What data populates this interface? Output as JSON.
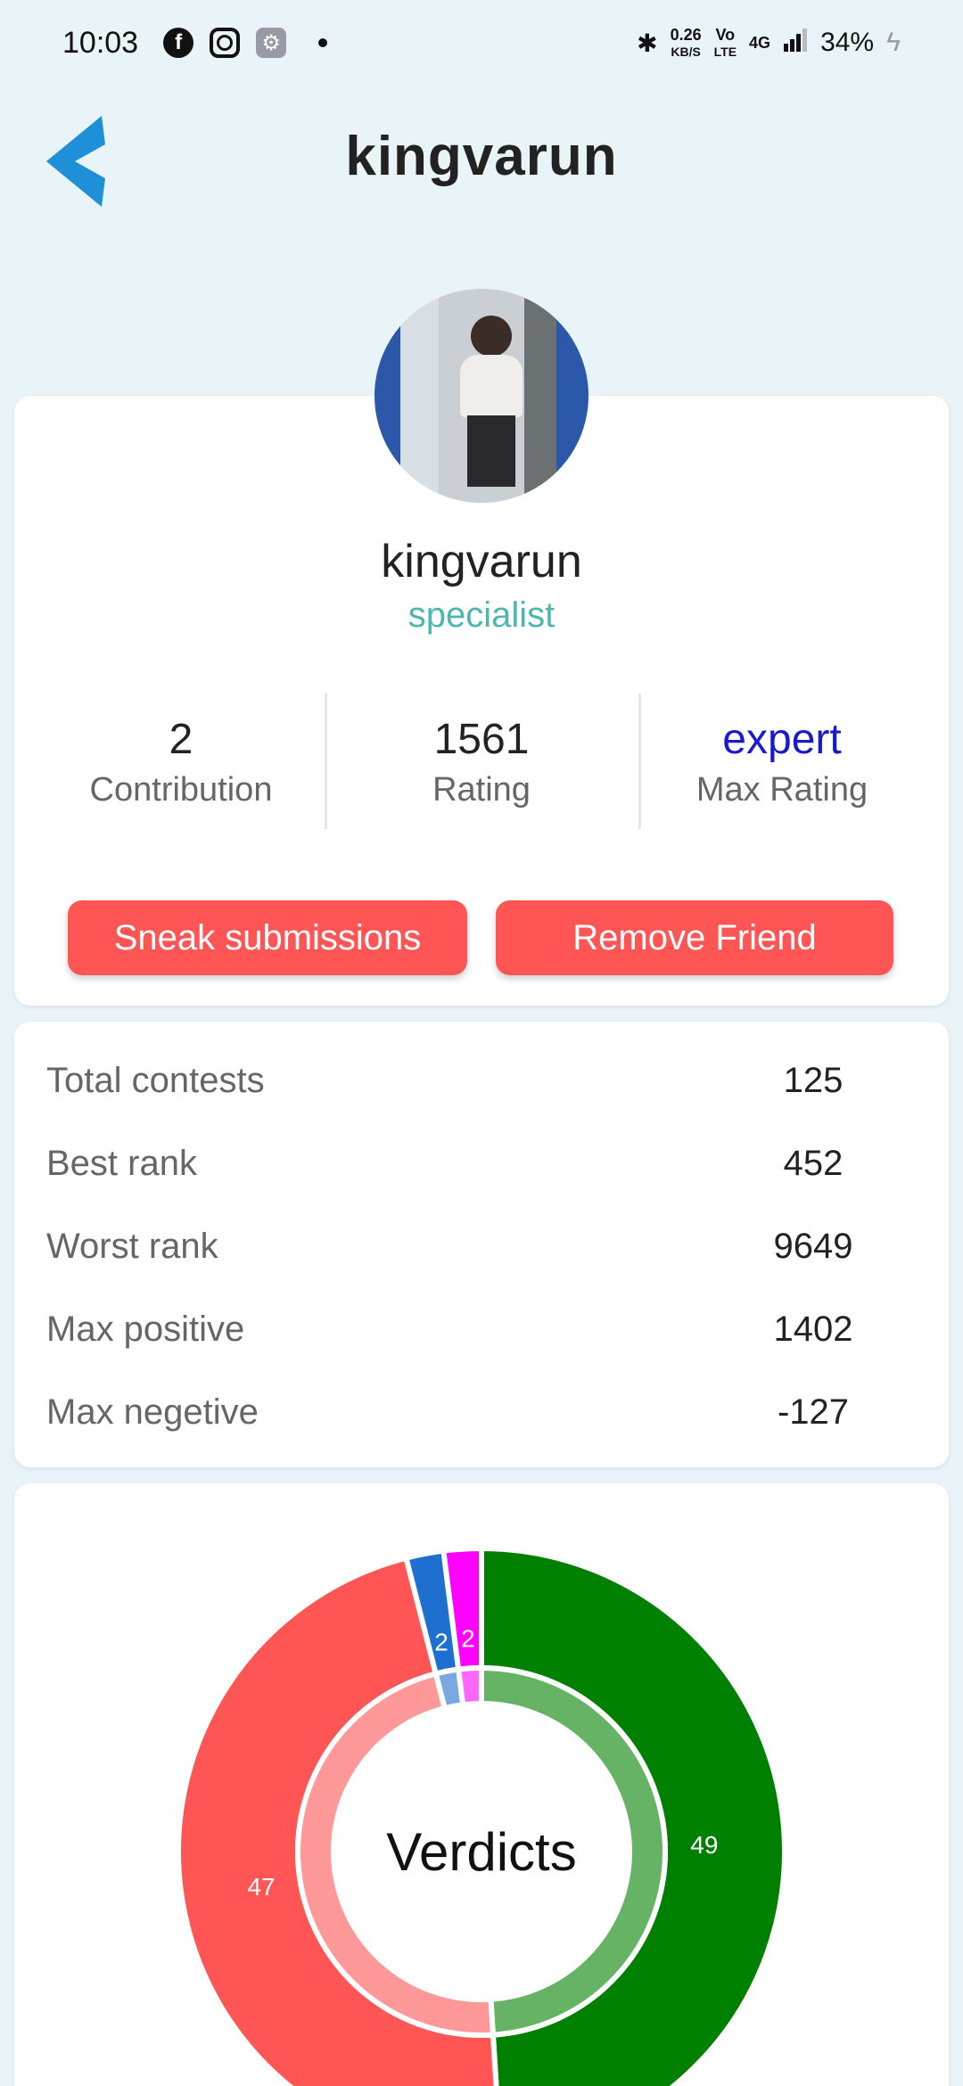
{
  "status_bar": {
    "time": "10:03",
    "network_speed_value": "0.26",
    "network_speed_unit": "KB/S",
    "volte_top": "Vo",
    "volte_bottom": "LTE",
    "network_type": "4G",
    "battery": "34%",
    "icons": [
      "facebook-icon",
      "instagram-icon",
      "settings-app-icon",
      "notification-dot",
      "bluetooth-icon",
      "signal-icon",
      "charging-icon"
    ]
  },
  "app_bar": {
    "title": "kingvarun",
    "back_icon": "chevron-left-icon",
    "accent": "#1e90d8"
  },
  "profile": {
    "name": "kingvarun",
    "rank": "specialist",
    "rank_color": "#4bb7ae",
    "stats": [
      {
        "value": "2",
        "label": "Contribution"
      },
      {
        "value": "1561",
        "label": "Rating"
      },
      {
        "value": "expert",
        "label": "Max Rating"
      }
    ],
    "max_rating_color": "#1a1acc",
    "buttons": {
      "sneak": "Sneak submissions",
      "remove": "Remove Friend",
      "color": "#ff5555"
    }
  },
  "contest_stats": [
    {
      "label": "Total contests",
      "value": "125"
    },
    {
      "label": "Best rank",
      "value": "452"
    },
    {
      "label": "Worst rank",
      "value": "9649"
    },
    {
      "label": "Max positive",
      "value": "1402"
    },
    {
      "label": "Max negetive",
      "value": "-127"
    }
  ],
  "chart_data": {
    "type": "pie",
    "title": "Verdicts",
    "slices": [
      {
        "value": 49,
        "label": "49",
        "color": "#008000"
      },
      {
        "value": 47,
        "label": "47",
        "color": "#ff5555"
      },
      {
        "value": 2,
        "label": "2",
        "color": "#1f6fd0"
      },
      {
        "value": 2,
        "label": "2",
        "color": "#ff00ff"
      }
    ]
  }
}
